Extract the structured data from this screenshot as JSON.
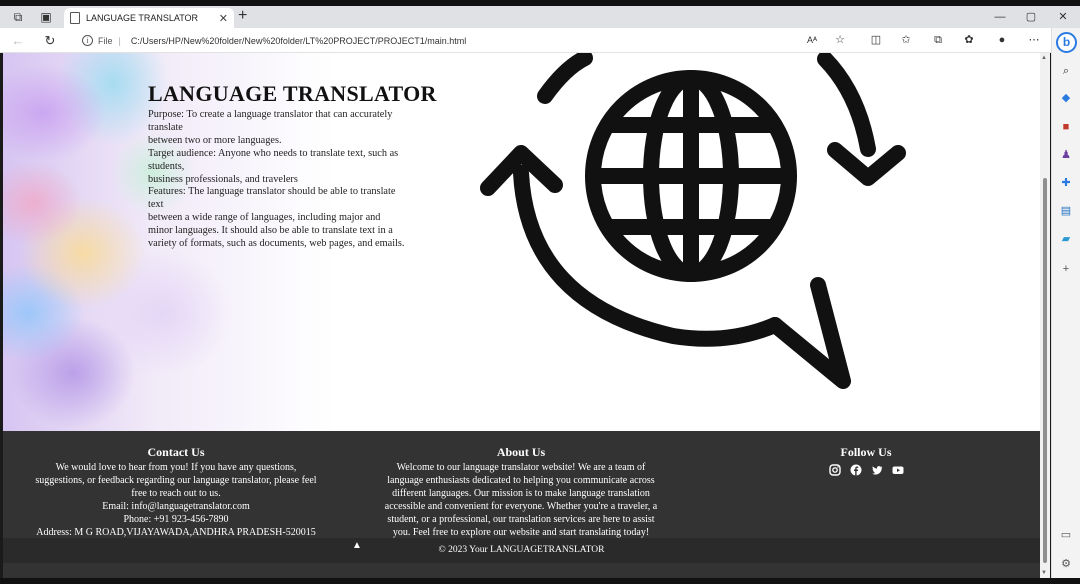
{
  "browser": {
    "tab_title": "LANGUAGE TRANSLATOR",
    "tab_close": "✕",
    "new_tab": "+",
    "address_label": "File",
    "address_separator": "|",
    "url": "C:/Users/HP/New%20folder/New%20folder/LT%20PROJECT/PROJECT1/main.html",
    "read_aloud": "Aᴬ",
    "window_controls": {
      "minimize": "—",
      "maximize": "▢",
      "close": "✕"
    }
  },
  "hero": {
    "title": "LANGUAGE TRANSLATOR",
    "lines": [
      "Purpose: To create a language translator that can accurately",
      "translate",
      "between two or more languages.",
      "Target audience: Anyone who needs to translate text, such as",
      "students,",
      "business professionals, and travelers",
      "Features: The language translator should be able to translate",
      "text",
      "between a wide range of languages, including major and",
      "minor languages. It should also be able to translate text in a",
      "variety of formats, such as documents, web pages, and emails."
    ]
  },
  "footer": {
    "contact": {
      "heading": "Contact Us",
      "lines": [
        "We would love to hear from you! If you have any questions,",
        "suggestions, or feedback regarding our language translator, please feel",
        "free to reach out to us.",
        "Email: info@languagetranslator.com",
        "Phone: +91 923-456-7890",
        "Address: M G ROAD,VIJAYAWADA,ANDHRA PRADESH-520015"
      ]
    },
    "about": {
      "heading": "About Us",
      "lines": [
        "Welcome to our language translator website! We are a team of",
        "language enthusiasts dedicated to helping you communicate across",
        "different languages. Our mission is to make language translation",
        "accessible and convenient for everyone. Whether you're a traveler, a",
        "student, or a professional, our translation services are here to assist",
        "you. Feel free to explore our website and start translating today!"
      ]
    },
    "follow": {
      "heading": "Follow Us",
      "icons": [
        "instagram-icon",
        "facebook-icon",
        "twitter-icon",
        "youtube-icon"
      ]
    },
    "copyright": "© 2023 Your LANGUAGETRANSLATOR"
  },
  "colors": {
    "footer_bg": "#333333",
    "copyright_bg": "#2a2a2a",
    "graphic": "#111111",
    "accent": "#2a7ae2"
  }
}
